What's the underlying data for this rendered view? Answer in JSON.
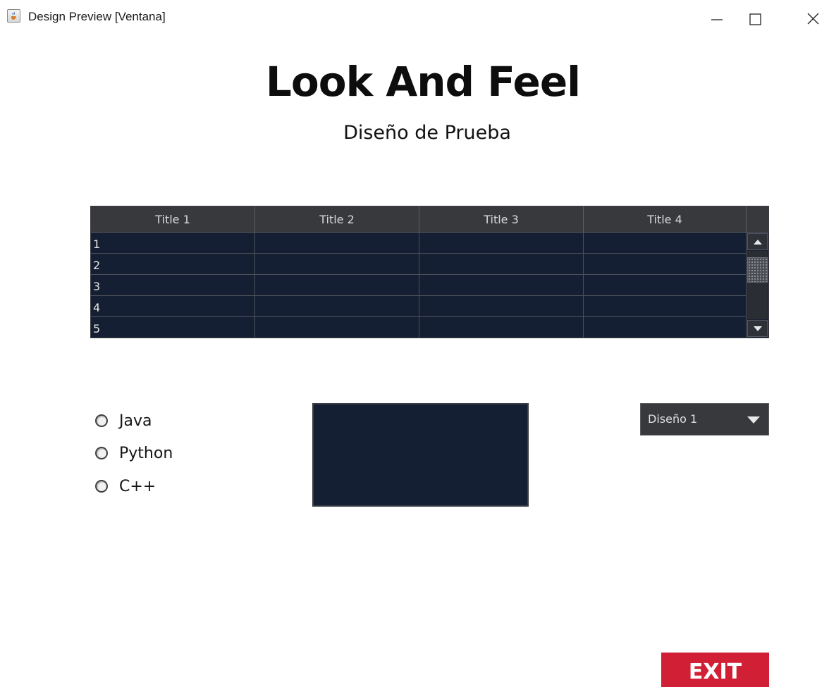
{
  "window": {
    "title": "Design Preview [Ventana]",
    "icon": "java-cup-icon",
    "controls": [
      "minimize-icon",
      "maximize-icon",
      "close-icon"
    ]
  },
  "header": {
    "title": "Look And Feel",
    "subtitle": "Diseño de Prueba"
  },
  "table": {
    "columns": [
      "Title 1",
      "Title 2",
      "Title 3",
      "Title 4"
    ],
    "rows": [
      [
        "1",
        "",
        "",
        ""
      ],
      [
        "2",
        "",
        "",
        ""
      ],
      [
        "3",
        "",
        "",
        ""
      ],
      [
        "4",
        "",
        "",
        ""
      ],
      [
        "5",
        "",
        "",
        ""
      ]
    ]
  },
  "radios": [
    {
      "label": "Java",
      "selected": false
    },
    {
      "label": "Python",
      "selected": false
    },
    {
      "label": "C++",
      "selected": false
    }
  ],
  "text_area": {
    "value": ""
  },
  "combo": {
    "selected": "Diseño 1"
  },
  "exit_button": {
    "label": "EXIT"
  },
  "colors": {
    "table_background": "#151f33",
    "header_background": "#38393d",
    "exit_button": "#d11f35"
  }
}
